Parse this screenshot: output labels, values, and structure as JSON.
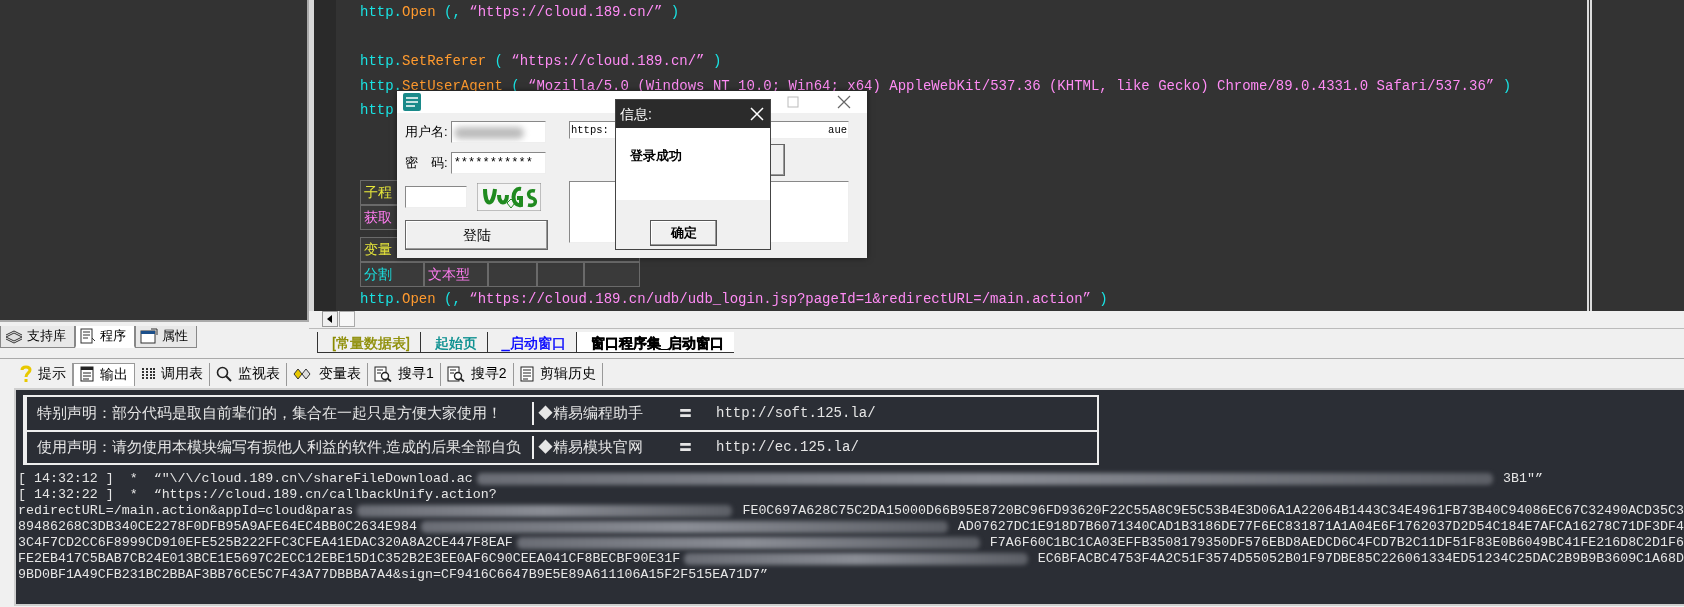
{
  "left_panel": {
    "tabs": [
      {
        "label": "支持库",
        "kind": "library",
        "selected": false
      },
      {
        "label": "程序",
        "kind": "program",
        "selected": true
      },
      {
        "label": "属性",
        "kind": "property",
        "selected": false
      }
    ]
  },
  "editor": {
    "lines": [
      {
        "kind": "code",
        "tokens": [
          {
            "text": "http.",
            "kind": "object"
          },
          {
            "text": "Open",
            "kind": "method"
          },
          {
            "text": " (, ",
            "kind": "punct"
          },
          {
            "text": "“https://cloud.189.cn/”",
            "kind": "string"
          },
          {
            "text": " )",
            "kind": "punct"
          }
        ]
      },
      {
        "kind": "blank"
      },
      {
        "kind": "code",
        "tokens": [
          {
            "text": "http.",
            "kind": "object"
          },
          {
            "text": "SetReferer",
            "kind": "method"
          },
          {
            "text": " ( ",
            "kind": "punct"
          },
          {
            "text": "“https://cloud.189.cn/”",
            "kind": "string"
          },
          {
            "text": " )",
            "kind": "punct"
          }
        ]
      },
      {
        "kind": "code",
        "tokens": [
          {
            "text": "http.",
            "kind": "object"
          },
          {
            "text": "SetUserAgent",
            "kind": "method"
          },
          {
            "text": " ( ",
            "kind": "punct"
          },
          {
            "text": "“Mozilla/5.0 (Windows NT 10.0; Win64; x64) AppleWebKit/537.36 (KHTML, like Gecko) Chrome/89.0.4331.0 Safari/537.36”",
            "kind": "string"
          },
          {
            "text": " )",
            "kind": "punct"
          }
        ]
      },
      {
        "kind": "code",
        "tokens": [
          {
            "text": "http",
            "kind": "object"
          }
        ]
      },
      {
        "kind": "blank"
      },
      {
        "kind": "blank"
      },
      {
        "kind": "table",
        "rows": [
          {
            "cells": [
              {
                "text": "子程",
                "kind": "heading"
              }
            ]
          },
          {
            "cells": [
              {
                "text": "获取",
                "kind": "type"
              }
            ]
          }
        ]
      },
      {
        "kind": "table",
        "rows": [
          {
            "cells": [
              {
                "text": "变量",
                "kind": "heading"
              }
            ]
          },
          {
            "cells": [
              {
                "text": "分割",
                "kind": "name"
              },
              {
                "text": "文本型",
                "kind": "type"
              },
              {
                "kind": "blank"
              },
              {
                "kind": "blank"
              },
              {
                "kind": "blank"
              }
            ]
          }
        ]
      },
      {
        "kind": "code",
        "tokens": [
          {
            "text": "http.",
            "kind": "object"
          },
          {
            "text": "Open",
            "kind": "method"
          },
          {
            "text": " (, ",
            "kind": "punct"
          },
          {
            "text": "“https://cloud.189.cn/udb/udb_login.jsp?pageId=1&redirectURL=/main.action”",
            "kind": "string"
          },
          {
            "text": " )",
            "kind": "punct"
          }
        ]
      }
    ],
    "tabs": [
      {
        "label": "[常量数据表]",
        "color": "#8c8c00",
        "selected": false
      },
      {
        "label": "起始页",
        "color": "#008c8c",
        "selected": false
      },
      {
        "label": "_启动窗口",
        "color": "#0000ff",
        "selected": false
      },
      {
        "label": "窗口程序集_启动窗口",
        "color": "#000000",
        "selected": true
      }
    ]
  },
  "login_window": {
    "username": {
      "label": "用户名:",
      "redacted": true
    },
    "password": {
      "label": "密　码:",
      "value": "***********"
    },
    "login_button": "登陆",
    "url_field": {
      "parts": [
        "https:",
        "aue"
      ]
    }
  },
  "message_dialog": {
    "title": "信息:",
    "message": "登录成功",
    "button": "确定"
  },
  "bottom_tabs": [
    {
      "label": "提示",
      "kind": "hint",
      "selected": false
    },
    {
      "label": "输出",
      "kind": "output",
      "selected": true
    },
    {
      "label": "调用表",
      "kind": "calls",
      "selected": false
    },
    {
      "label": "监视表",
      "kind": "watch",
      "selected": false
    },
    {
      "label": "变量表",
      "kind": "vars",
      "selected": false
    },
    {
      "label": "搜寻1",
      "kind": "search",
      "selected": false
    },
    {
      "label": "搜寻2",
      "kind": "search",
      "selected": false
    },
    {
      "label": "剪辑历史",
      "kind": "clip",
      "selected": false
    }
  ],
  "output": {
    "banner": [
      {
        "text": "特别声明：部分代码是取自前辈们的，集合在一起只是方便大家使用！",
        "site": "◆精易编程助手",
        "symbol": "〓",
        "url": "http://soft.125.la/"
      },
      {
        "text": "使用声明：请勿使用本模块编写有损他人利益的软件,造成的后果全部自负",
        "site": "◆精易模块官网",
        "symbol": "〓",
        "url": "http://ec.125.la/"
      }
    ],
    "log_lines": [
      {
        "segments": [
          "[ 14:32:12 ]  *  “\"\\/\\/cloud.189.cn\\/shareFileDownload.ac",
          "3B1\"”"
        ]
      },
      {
        "segments": [
          "[ 14:32:22 ]  *  “https://cloud.189.cn/callbackUnify.action?"
        ]
      },
      {
        "segments": [
          "redirectURL=/main.action&appId=cloud&paras",
          "FE0C697A628C75C2DA15000D66B95E8720BC96FD93620F22C55A8C9E5C53B4E3D06A1A22064B1443C34E4961FB73B40C94086EC67C32490ACD35C3"
        ]
      },
      {
        "segments": [
          "89486268C3DB340CE2278F0DFB95A9AFE64EC4BB0C2634E984",
          "AD07627DC1E918D7B6071340CAD1B3186DE77F6EC831871A1A04E6F1762037D2D54C184E7AFCA16278C71DF3DF4"
        ]
      },
      {
        "segments": [
          "3C4F7CD2CC6F8999CD910EFE525B222FFC3CFEA41EDAC320A8A2CE447F8EAF",
          "F7A6F60C1BC1CA03EFFB3508179350DF576EBD8AEDCD6C4FCD7B2C11DF51F83E0B6049BC41FE216D8C2D1F6"
        ]
      },
      {
        "segments": [
          "FE2EB417C5BAB7CB24E013BCE1E5697C2ECC12EBE15D1C352B2E3EE0AF6C90CEEA041CF8BECBF90E31F",
          "EC6BFACBC4753F4A2C51F3574D55052B01F97DBE85C226061334ED51234C25DAC2B9B9B3609C1A68D"
        ]
      },
      {
        "segments": [
          "9BD0BF1A49CFB231BC2BBAF3BB76CE5C7F43A77DBBBA7A4&sign=CF9416C6647B9E5E89A611106A15F2F515EA71D7”"
        ]
      }
    ]
  }
}
